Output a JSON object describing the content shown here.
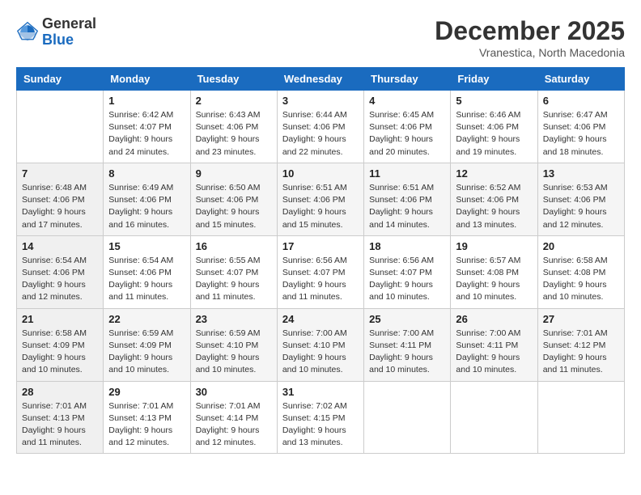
{
  "header": {
    "logo": {
      "general": "General",
      "blue": "Blue"
    },
    "title": "December 2025",
    "subtitle": "Vranestica, North Macedonia"
  },
  "weekdays": [
    "Sunday",
    "Monday",
    "Tuesday",
    "Wednesday",
    "Thursday",
    "Friday",
    "Saturday"
  ],
  "weeks": [
    [
      {
        "day": "",
        "info": ""
      },
      {
        "day": "1",
        "info": "Sunrise: 6:42 AM\nSunset: 4:07 PM\nDaylight: 9 hours\nand 24 minutes."
      },
      {
        "day": "2",
        "info": "Sunrise: 6:43 AM\nSunset: 4:06 PM\nDaylight: 9 hours\nand 23 minutes."
      },
      {
        "day": "3",
        "info": "Sunrise: 6:44 AM\nSunset: 4:06 PM\nDaylight: 9 hours\nand 22 minutes."
      },
      {
        "day": "4",
        "info": "Sunrise: 6:45 AM\nSunset: 4:06 PM\nDaylight: 9 hours\nand 20 minutes."
      },
      {
        "day": "5",
        "info": "Sunrise: 6:46 AM\nSunset: 4:06 PM\nDaylight: 9 hours\nand 19 minutes."
      },
      {
        "day": "6",
        "info": "Sunrise: 6:47 AM\nSunset: 4:06 PM\nDaylight: 9 hours\nand 18 minutes."
      }
    ],
    [
      {
        "day": "7",
        "info": "Sunrise: 6:48 AM\nSunset: 4:06 PM\nDaylight: 9 hours\nand 17 minutes."
      },
      {
        "day": "8",
        "info": "Sunrise: 6:49 AM\nSunset: 4:06 PM\nDaylight: 9 hours\nand 16 minutes."
      },
      {
        "day": "9",
        "info": "Sunrise: 6:50 AM\nSunset: 4:06 PM\nDaylight: 9 hours\nand 15 minutes."
      },
      {
        "day": "10",
        "info": "Sunrise: 6:51 AM\nSunset: 4:06 PM\nDaylight: 9 hours\nand 15 minutes."
      },
      {
        "day": "11",
        "info": "Sunrise: 6:51 AM\nSunset: 4:06 PM\nDaylight: 9 hours\nand 14 minutes."
      },
      {
        "day": "12",
        "info": "Sunrise: 6:52 AM\nSunset: 4:06 PM\nDaylight: 9 hours\nand 13 minutes."
      },
      {
        "day": "13",
        "info": "Sunrise: 6:53 AM\nSunset: 4:06 PM\nDaylight: 9 hours\nand 12 minutes."
      }
    ],
    [
      {
        "day": "14",
        "info": "Sunrise: 6:54 AM\nSunset: 4:06 PM\nDaylight: 9 hours\nand 12 minutes."
      },
      {
        "day": "15",
        "info": "Sunrise: 6:54 AM\nSunset: 4:06 PM\nDaylight: 9 hours\nand 11 minutes."
      },
      {
        "day": "16",
        "info": "Sunrise: 6:55 AM\nSunset: 4:07 PM\nDaylight: 9 hours\nand 11 minutes."
      },
      {
        "day": "17",
        "info": "Sunrise: 6:56 AM\nSunset: 4:07 PM\nDaylight: 9 hours\nand 11 minutes."
      },
      {
        "day": "18",
        "info": "Sunrise: 6:56 AM\nSunset: 4:07 PM\nDaylight: 9 hours\nand 10 minutes."
      },
      {
        "day": "19",
        "info": "Sunrise: 6:57 AM\nSunset: 4:08 PM\nDaylight: 9 hours\nand 10 minutes."
      },
      {
        "day": "20",
        "info": "Sunrise: 6:58 AM\nSunset: 4:08 PM\nDaylight: 9 hours\nand 10 minutes."
      }
    ],
    [
      {
        "day": "21",
        "info": "Sunrise: 6:58 AM\nSunset: 4:09 PM\nDaylight: 9 hours\nand 10 minutes."
      },
      {
        "day": "22",
        "info": "Sunrise: 6:59 AM\nSunset: 4:09 PM\nDaylight: 9 hours\nand 10 minutes."
      },
      {
        "day": "23",
        "info": "Sunrise: 6:59 AM\nSunset: 4:10 PM\nDaylight: 9 hours\nand 10 minutes."
      },
      {
        "day": "24",
        "info": "Sunrise: 7:00 AM\nSunset: 4:10 PM\nDaylight: 9 hours\nand 10 minutes."
      },
      {
        "day": "25",
        "info": "Sunrise: 7:00 AM\nSunset: 4:11 PM\nDaylight: 9 hours\nand 10 minutes."
      },
      {
        "day": "26",
        "info": "Sunrise: 7:00 AM\nSunset: 4:11 PM\nDaylight: 9 hours\nand 10 minutes."
      },
      {
        "day": "27",
        "info": "Sunrise: 7:01 AM\nSunset: 4:12 PM\nDaylight: 9 hours\nand 11 minutes."
      }
    ],
    [
      {
        "day": "28",
        "info": "Sunrise: 7:01 AM\nSunset: 4:13 PM\nDaylight: 9 hours\nand 11 minutes."
      },
      {
        "day": "29",
        "info": "Sunrise: 7:01 AM\nSunset: 4:13 PM\nDaylight: 9 hours\nand 12 minutes."
      },
      {
        "day": "30",
        "info": "Sunrise: 7:01 AM\nSunset: 4:14 PM\nDaylight: 9 hours\nand 12 minutes."
      },
      {
        "day": "31",
        "info": "Sunrise: 7:02 AM\nSunset: 4:15 PM\nDaylight: 9 hours\nand 13 minutes."
      },
      {
        "day": "",
        "info": ""
      },
      {
        "day": "",
        "info": ""
      },
      {
        "day": "",
        "info": ""
      }
    ]
  ]
}
